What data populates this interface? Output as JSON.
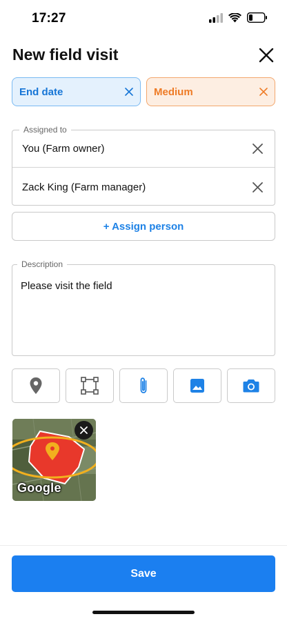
{
  "status_bar": {
    "time": "17:27"
  },
  "header": {
    "title": "New field visit"
  },
  "chips": [
    {
      "label": "End date",
      "color": "#1675d6",
      "background": "#e4f1fd"
    },
    {
      "label": "Medium",
      "color": "#ee7b26",
      "background": "#fdeee2"
    }
  ],
  "assigned": {
    "legend": "Assigned to",
    "people": [
      {
        "name": "You (Farm owner)"
      },
      {
        "name": "Zack King (Farm manager)"
      }
    ]
  },
  "assign_button": {
    "label": "+ Assign person"
  },
  "description": {
    "legend": "Description",
    "value": "Please visit the field"
  },
  "toolbar": {
    "icons": [
      "location-pin-icon",
      "polygon-draw-icon",
      "attachment-icon",
      "image-icon",
      "camera-icon"
    ]
  },
  "map_thumbnail": {
    "watermark": "Google"
  },
  "footer": {
    "save_label": "Save"
  },
  "colors": {
    "accent": "#1b7ff0",
    "highlight_ring": "#f2b01e",
    "field_red": "#e8382b"
  }
}
